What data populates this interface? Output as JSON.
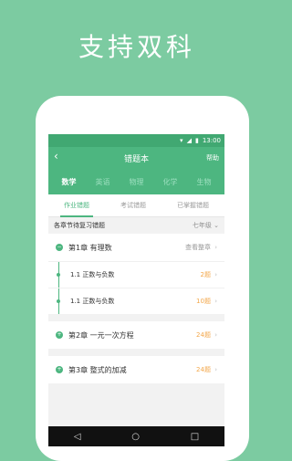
{
  "headline": "支持双科",
  "status": {
    "time": "13:00"
  },
  "appbar": {
    "title": "错题本",
    "help": "帮助"
  },
  "subjects": [
    "数学",
    "英语",
    "物理",
    "化学",
    "生物"
  ],
  "tabs": [
    "作业错题",
    "考试错题",
    "已掌握错题"
  ],
  "filter": {
    "label": "各章节待复习错题",
    "grade": "七年级"
  },
  "chapters": [
    {
      "title": "第1章 有理数",
      "right": "查看整章",
      "subs": [
        {
          "title": "1.1 正数与负数",
          "count": "2题"
        },
        {
          "title": "1.1 正数与负数",
          "count": "10题"
        }
      ]
    },
    {
      "title": "第2章 一元一次方程",
      "count": "24题"
    },
    {
      "title": "第3章 整式的加减",
      "count": "24题"
    }
  ]
}
